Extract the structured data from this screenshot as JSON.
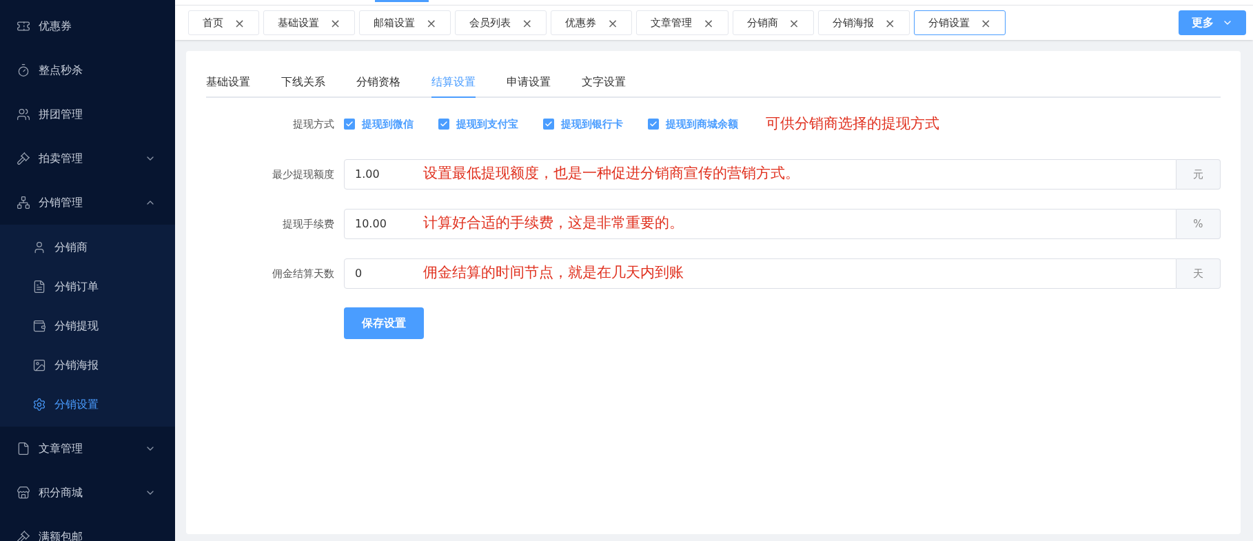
{
  "sidebar": {
    "items": [
      {
        "label": "优惠券",
        "kind": "link"
      },
      {
        "label": "整点秒杀",
        "kind": "link"
      },
      {
        "label": "拼团管理",
        "kind": "link"
      },
      {
        "label": "拍卖管理",
        "kind": "submenu",
        "expanded": false
      },
      {
        "label": "分销管理",
        "kind": "submenu",
        "expanded": true,
        "children": [
          {
            "label": "分销商",
            "selected": false
          },
          {
            "label": "分销订单",
            "selected": false
          },
          {
            "label": "分销提现",
            "selected": false
          },
          {
            "label": "分销海报",
            "selected": false
          },
          {
            "label": "分销设置",
            "selected": true
          }
        ]
      },
      {
        "label": "文章管理",
        "kind": "submenu",
        "expanded": false
      },
      {
        "label": "积分商城",
        "kind": "submenu",
        "expanded": false
      },
      {
        "label": "满额包邮",
        "kind": "link"
      }
    ]
  },
  "page_tabs": [
    {
      "label": "首页",
      "close": "×",
      "selected": false
    },
    {
      "label": "基础设置",
      "close": "×",
      "selected": false
    },
    {
      "label": "邮箱设置",
      "close": "×",
      "selected": false
    },
    {
      "label": "会员列表",
      "close": "×",
      "selected": false
    },
    {
      "label": "优惠券",
      "close": "×",
      "selected": false
    },
    {
      "label": "文章管理",
      "close": "×",
      "selected": false
    },
    {
      "label": "分销商",
      "close": "×",
      "selected": false
    },
    {
      "label": "分销海报",
      "close": "×",
      "selected": false
    },
    {
      "label": "分销设置",
      "close": "×",
      "selected": true
    }
  ],
  "more_button": "更多",
  "settings_tabs": [
    {
      "label": "基础设置",
      "selected": false
    },
    {
      "label": "下线关系",
      "selected": false
    },
    {
      "label": "分销资格",
      "selected": false
    },
    {
      "label": "结算设置",
      "selected": true
    },
    {
      "label": "申请设置",
      "selected": false
    },
    {
      "label": "文字设置",
      "selected": false
    }
  ],
  "withdraw_methods": {
    "label": "提现方式",
    "options": [
      {
        "label": "提现到微信",
        "checked": true
      },
      {
        "label": "提现到支付宝",
        "checked": true
      },
      {
        "label": "提现到银行卡",
        "checked": true
      },
      {
        "label": "提现到商城余额",
        "checked": true
      }
    ],
    "annotation": "可供分销商选择的提现方式"
  },
  "fields": [
    {
      "label": "最少提现额度",
      "value": "1.00",
      "suffix": "元",
      "annotation": "设置最低提现额度，也是一种促进分销商宣传的营销方式。"
    },
    {
      "label": "提现手续费",
      "value": "10.00",
      "suffix": "%",
      "annotation": "计算好合适的手续费，这是非常重要的。"
    },
    {
      "label": "佣金结算天数",
      "value": "0",
      "suffix": "天",
      "annotation": "佣金结算的时间节点，就是在几天内到账"
    }
  ],
  "save_button": "保存设置"
}
